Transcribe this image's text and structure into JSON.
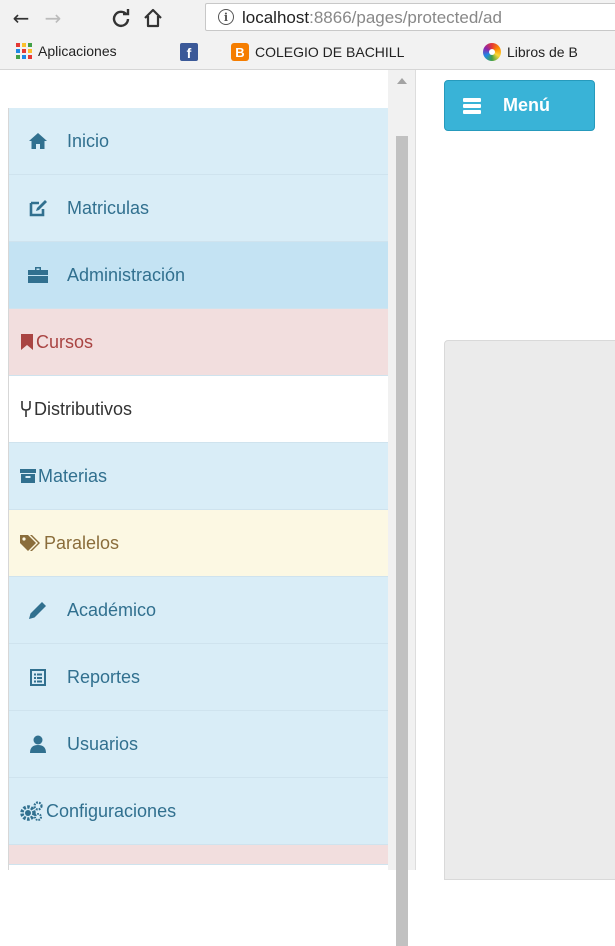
{
  "browser": {
    "url_host": "localhost",
    "url_rest": ":8866/pages/protected/ad",
    "bookmarks": [
      {
        "label": "Aplicaciones",
        "icon": "apps-grid-icon"
      },
      {
        "label": "",
        "icon": "facebook-icon"
      },
      {
        "label": "COLEGIO DE BACHILL",
        "icon": "blogger-icon"
      },
      {
        "label": "Libros de B",
        "icon": "flower-logo-icon"
      }
    ]
  },
  "sidebar": {
    "items": [
      {
        "label": "Inicio",
        "icon": "home-icon",
        "bg": "#d9edf7",
        "color": "#31708f"
      },
      {
        "label": "Matriculas",
        "icon": "edit-icon",
        "bg": "#d9edf7",
        "color": "#31708f"
      },
      {
        "label": "Administración",
        "icon": "briefcase-icon",
        "bg": "#c4e3f3",
        "color": "#31708f"
      },
      {
        "label": "Cursos",
        "icon": "bookmark-icon",
        "bg": "#f2dede",
        "color": "#a94442"
      },
      {
        "label": "Distributivos",
        "icon": "fork-icon",
        "bg": "#ffffff",
        "color": "#333333"
      },
      {
        "label": "Materias",
        "icon": "archive-icon",
        "bg": "#d9edf7",
        "color": "#31708f"
      },
      {
        "label": "Paralelos",
        "icon": "tags-icon",
        "bg": "#fcf8e3",
        "color": "#8a6d3b"
      },
      {
        "label": "Académico",
        "icon": "pencil-icon",
        "bg": "#d9edf7",
        "color": "#31708f"
      },
      {
        "label": "Reportes",
        "icon": "list-alt-icon",
        "bg": "#d9edf7",
        "color": "#31708f"
      },
      {
        "label": "Usuarios",
        "icon": "user-icon",
        "bg": "#d9edf7",
        "color": "#31708f"
      },
      {
        "label": "Configuraciones",
        "icon": "cogs-icon",
        "bg": "#d9edf7",
        "color": "#31708f"
      }
    ]
  },
  "main": {
    "menu_button_label": "Menú"
  },
  "colors": {
    "accent": "#39b3d7",
    "info_bg": "#d9edf7",
    "info_text": "#31708f"
  }
}
